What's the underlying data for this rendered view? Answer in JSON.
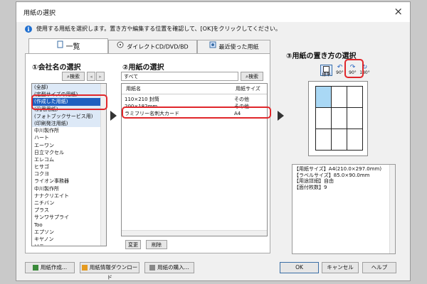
{
  "window": {
    "title": "用紙の選択",
    "close_label": "×"
  },
  "info_text": "使用する用紙を選択します。置き方や編集する位置を確認して、[OK]をクリックしてください。",
  "tabs": [
    {
      "label": "一覧",
      "active": true
    },
    {
      "label": "ダイレクトCD/DVD/BD",
      "active": false
    },
    {
      "label": "最近使った用紙",
      "active": false
    }
  ],
  "company": {
    "heading": "①会社名の選択",
    "search_label": "検索",
    "items": [
      "(全部)",
      "(定型サイズの用紙)",
      "(作成した用紙)",
      "(汎用用紙)",
      "(フォトブックサービス用)",
      "(印刷発注用紙)",
      "中川製作所",
      "ハート",
      "エーワン",
      "日立マクセル",
      "エレコム",
      "ヒサゴ",
      "コクヨ",
      "ライオン事務器",
      "中川製作所",
      "ナナクリエイト",
      "ニチバン",
      "プラス",
      "サンワサプライ",
      "Too",
      "エプソン",
      "キヤノン",
      "ソニー"
    ],
    "selected_index": 2
  },
  "paper": {
    "heading": "②用紙の選択",
    "filter_value": "すべて",
    "search_label": "検索",
    "columns": [
      "用紙名",
      "用紙サイズ"
    ],
    "rows": [
      {
        "name": "110×210 封筒",
        "size": "その他"
      },
      {
        "name": "200×182mm",
        "size": "その他"
      },
      {
        "name": "ラミフリー名刺大カード",
        "size": "A4"
      }
    ],
    "change_label": "変更",
    "delete_label": "削除"
  },
  "orientation": {
    "heading": "③用紙の置き方の選択",
    "options": [
      "標準",
      "90°",
      "90°",
      "180°"
    ],
    "details": [
      "【用紙サイズ】A4(210.0×297.0mm)",
      "【ラベルサイズ】85.0×90.0mm",
      "【用途詳細】自由",
      "【面付枚数】9"
    ]
  },
  "buttons": {
    "create": "用紙作成...",
    "download": "用紙情報ダウンロード",
    "buy": "用紙の購入...",
    "ok": "OK",
    "cancel": "キャンセル",
    "help": "ヘルプ"
  },
  "colors": {
    "highlight": "#e0262a",
    "selection": "#1f5fbf",
    "selected_cell": "#a9d8f5"
  }
}
